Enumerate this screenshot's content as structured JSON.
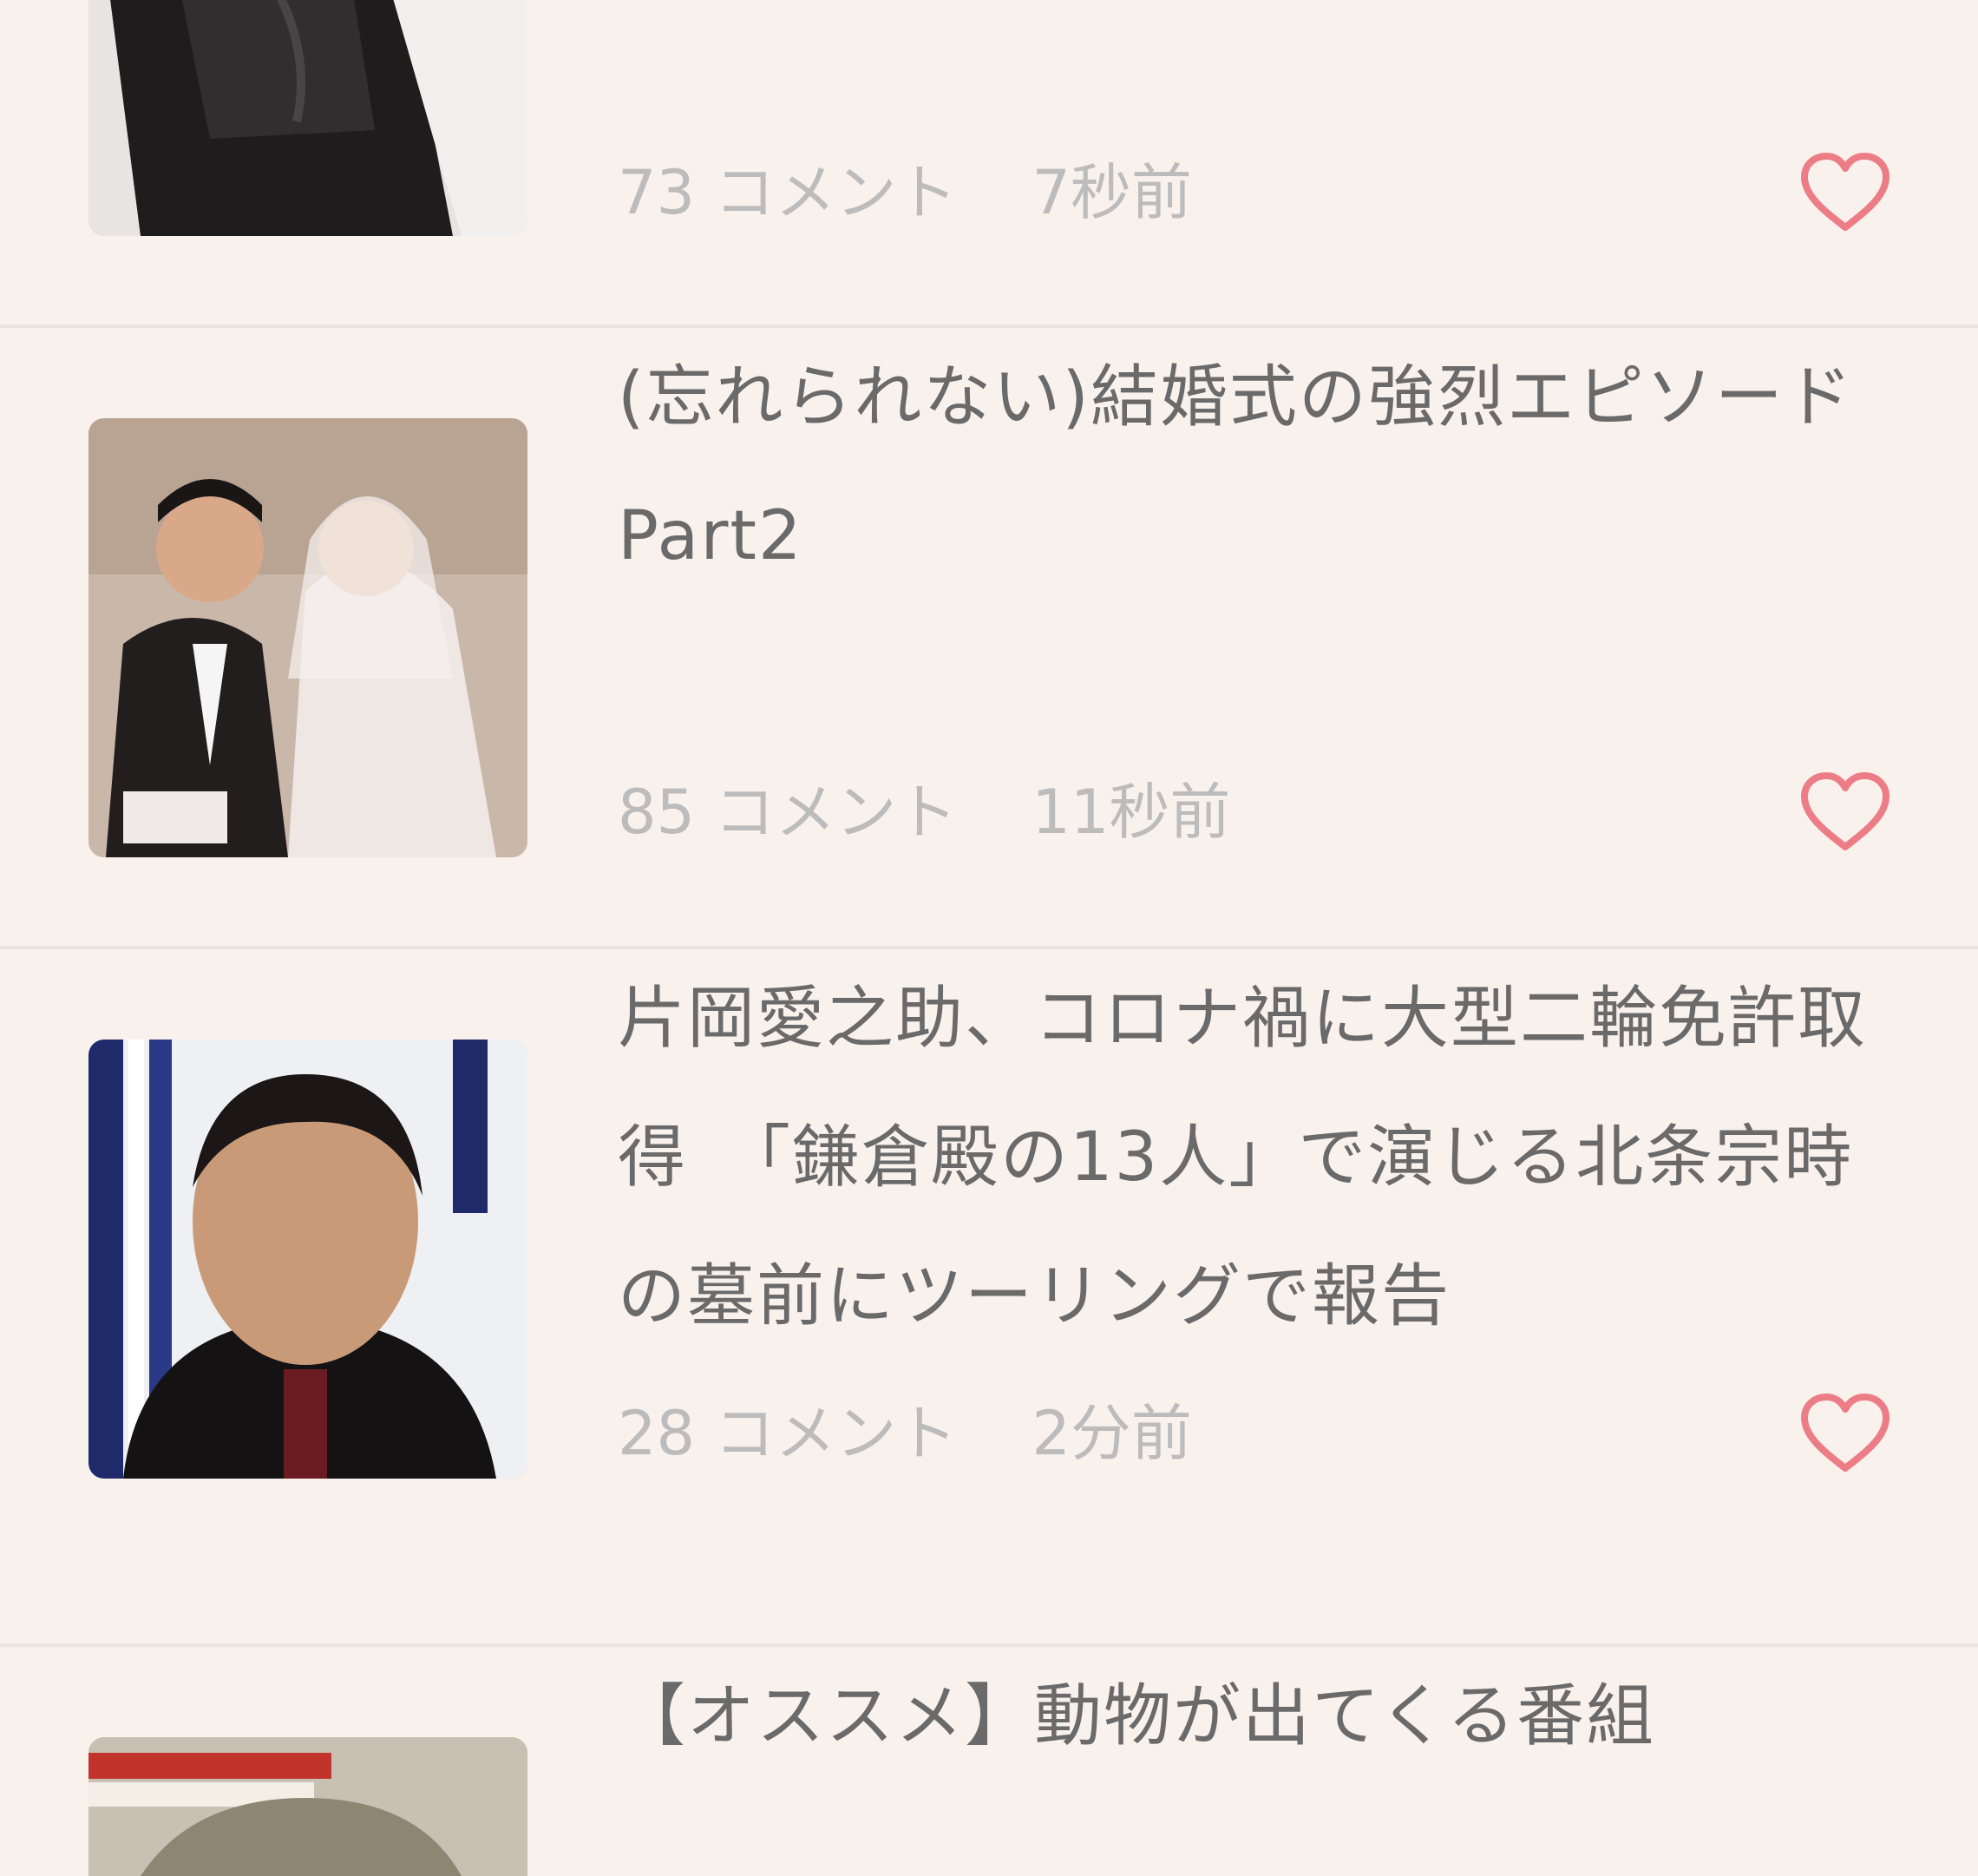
{
  "accent_color": "#ec7d86",
  "items": [
    {
      "title": "",
      "comments": "73 コメント",
      "time": "7秒前",
      "like_icon": "heart-outline-icon"
    },
    {
      "title": "(忘れられない)結婚式の強烈エピソードPart2",
      "comments": "85 コメント",
      "time": "11秒前",
      "like_icon": "heart-outline-icon"
    },
    {
      "title": "片岡愛之助、コロナ禍に大型二輪免許取得　「鎌倉殿の13人」で演じる北条宗時の墓前にツーリングで報告",
      "comments": "28 コメント",
      "time": "2分前",
      "like_icon": "heart-outline-icon"
    },
    {
      "title": "【オススメ】動物が出てくる番組",
      "comments": "",
      "time": "",
      "like_icon": ""
    }
  ]
}
